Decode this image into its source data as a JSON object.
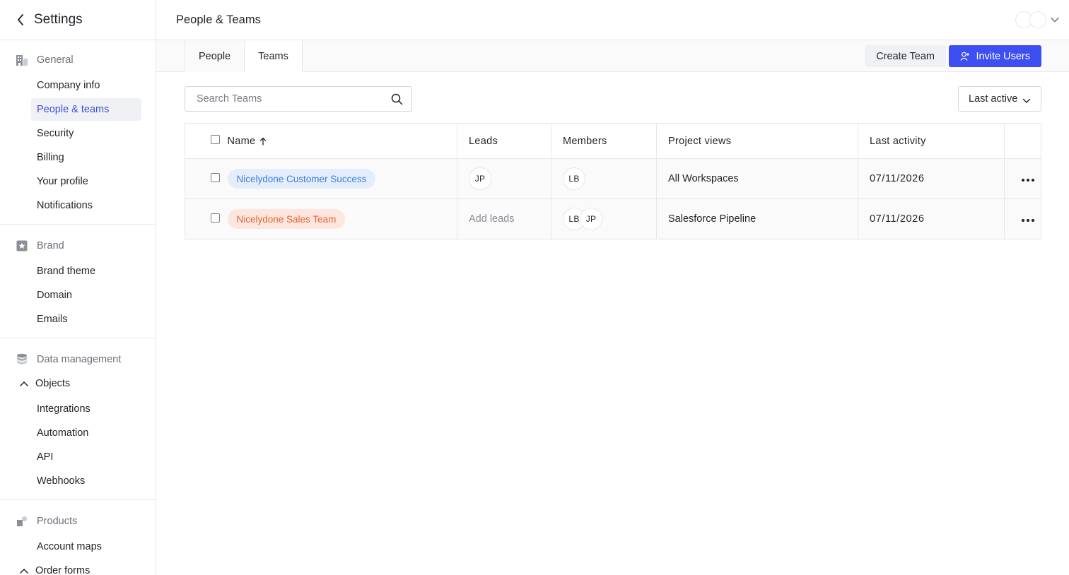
{
  "sidebar": {
    "title": "Settings",
    "sections": [
      {
        "group": "General",
        "icon": "building-icon",
        "items": [
          "Company info",
          "People & teams",
          "Security",
          "Billing",
          "Your profile",
          "Notifications"
        ]
      },
      {
        "group": "Brand",
        "icon": "star-icon",
        "items": [
          "Brand theme",
          "Domain",
          "Emails"
        ]
      },
      {
        "group": "Data management",
        "icon": "database-icon",
        "sub": "Objects",
        "items": [
          "Integrations",
          "Automation",
          "API",
          "Webhooks"
        ]
      },
      {
        "group": "Products",
        "icon": "products-icon",
        "items": [
          "Account maps"
        ],
        "sub": "Order forms"
      }
    ]
  },
  "header": {
    "title": "People & Teams"
  },
  "tabs": [
    "People",
    "Teams"
  ],
  "actions": {
    "create": "Create Team",
    "invite": "Invite Users"
  },
  "search": {
    "placeholder": "Search Teams"
  },
  "sort": {
    "selected": "Last active"
  },
  "table": {
    "columns": [
      "Name",
      "Leads",
      "Members",
      "Project views",
      "Last activity"
    ],
    "rows": [
      {
        "name": "Nicelydone Customer Success",
        "color": "#3b7ddd",
        "leads": [
          "JP"
        ],
        "members": [
          "LB"
        ],
        "project_views": "All Workspaces",
        "last_activity": "07/11/2026"
      },
      {
        "name": "Nicelydone Sales Team",
        "color": "#e0643a",
        "leads_placeholder": "Add leads",
        "members": [
          "LB",
          "JP"
        ],
        "project_views": "Salesforce Pipeline",
        "last_activity": "07/11/2026"
      }
    ]
  },
  "colors": {
    "accent": "#3d4ff0",
    "active_nav": "#3b4ee0"
  }
}
